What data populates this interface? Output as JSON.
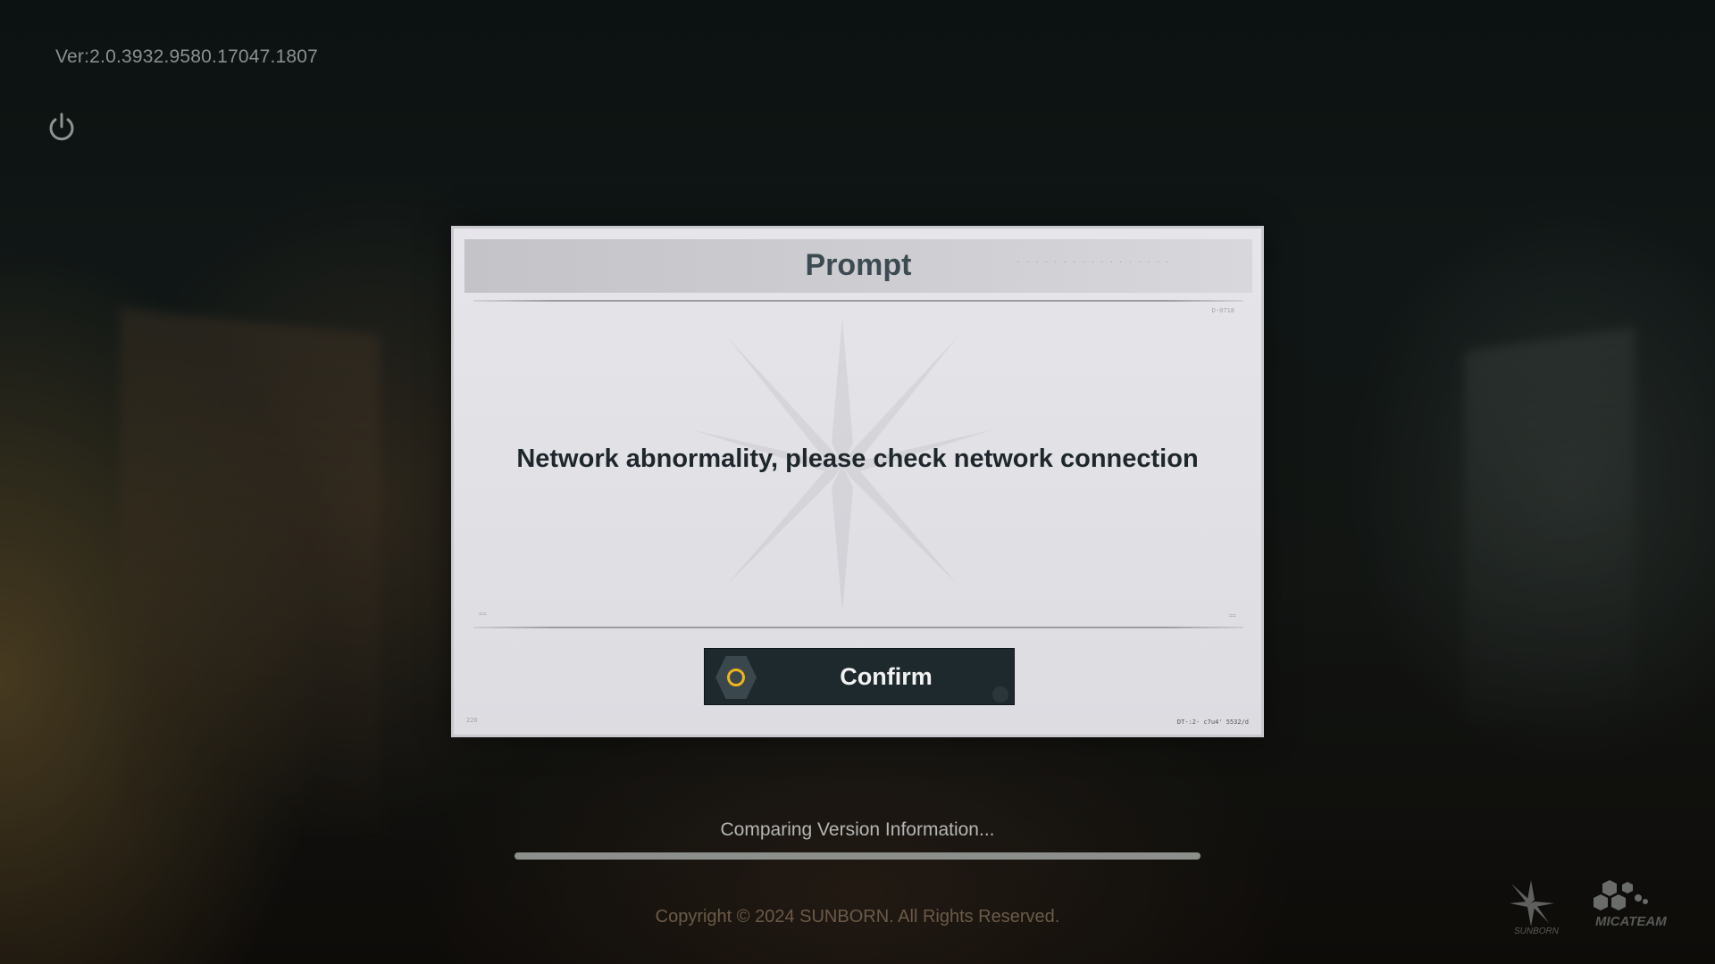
{
  "app": {
    "version": "Ver:2.0.3932.9580.17047.1807"
  },
  "dialog": {
    "title": "Prompt",
    "message": "Network abnormality, please check network connection",
    "confirm_label": "Confirm",
    "accent_color": "#f0b41e"
  },
  "loading": {
    "status": "Comparing Version Information...",
    "progress": 1.0
  },
  "footer": {
    "copyright": "Copyright © 2024 SUNBORN. All Rights Reserved.",
    "logos": [
      "SUNBORN",
      "MICATEAM"
    ]
  },
  "icons": {
    "power": "power-icon",
    "confirm": "circle-button-icon"
  }
}
